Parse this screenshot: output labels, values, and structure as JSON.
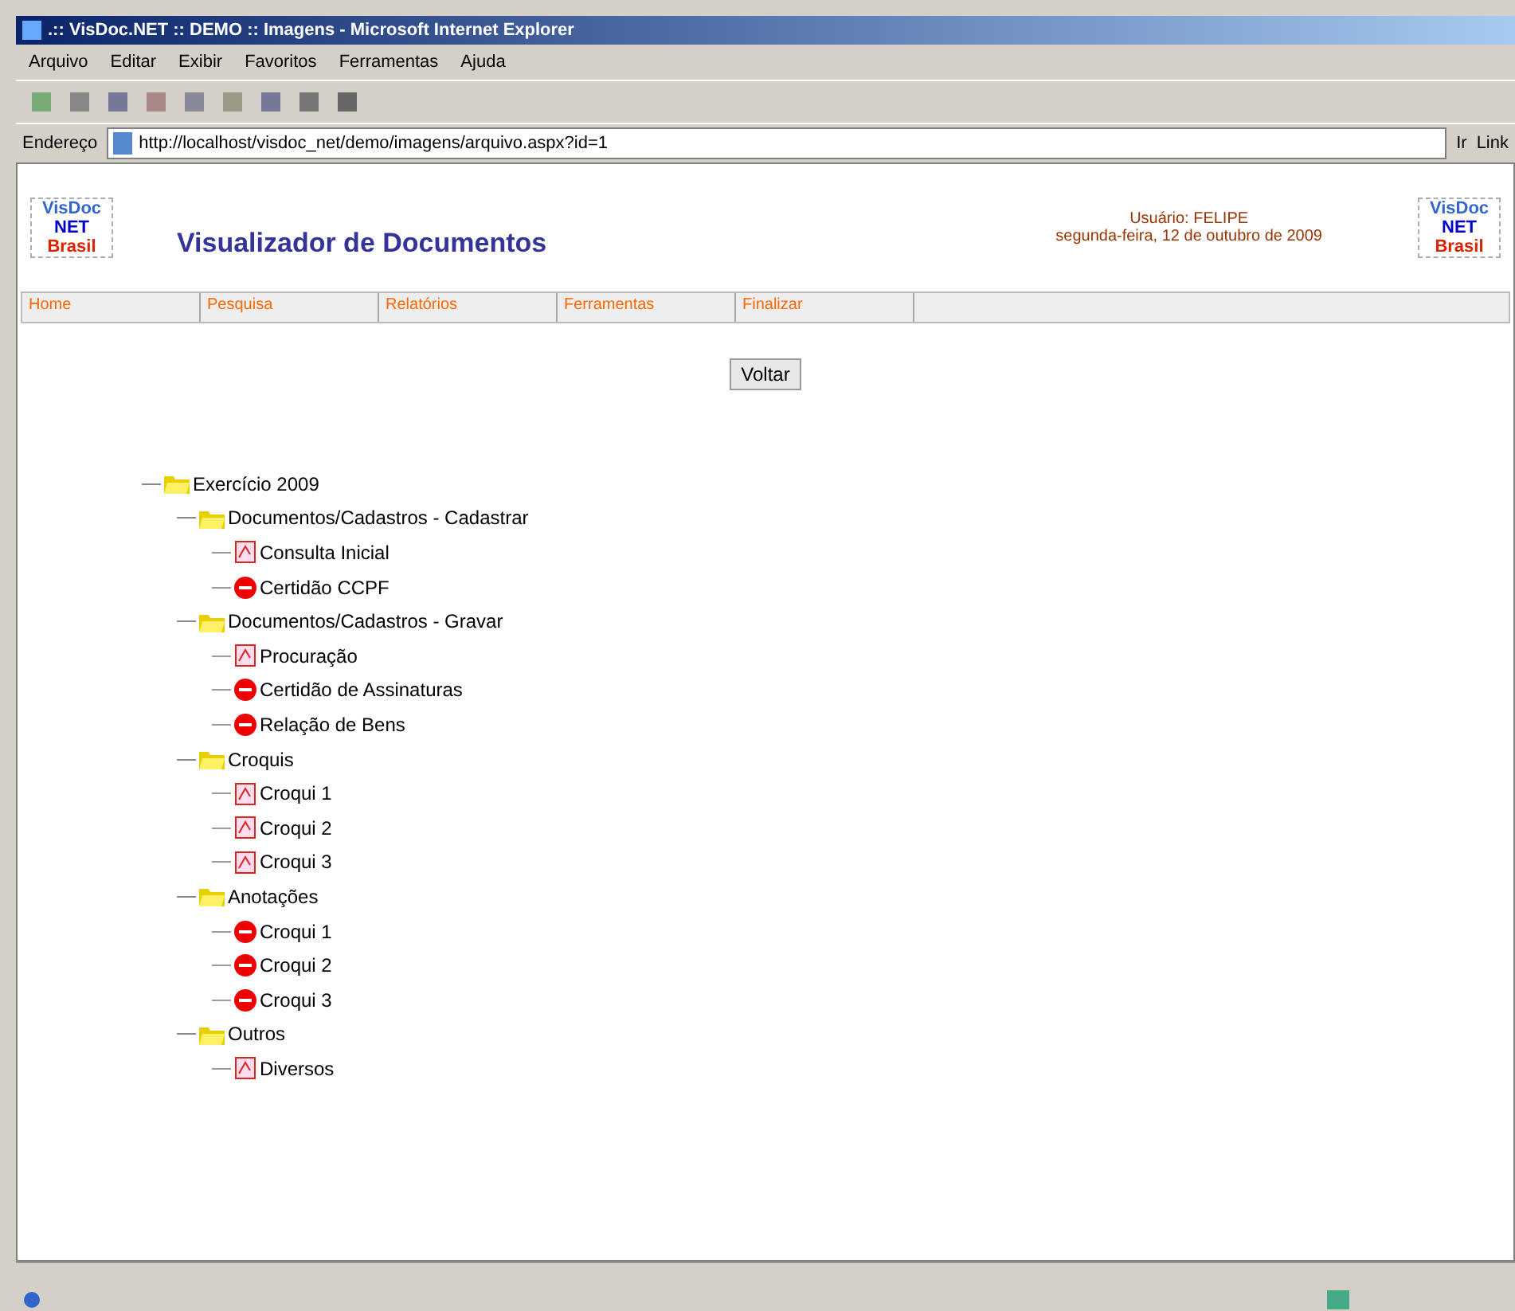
{
  "window": {
    "title": ".:: VisDoc.NET :: DEMO :: Imagens - Microsoft Internet Explorer"
  },
  "menu": [
    "Arquivo",
    "Editar",
    "Exibir",
    "Favoritos",
    "Ferramentas",
    "Ajuda"
  ],
  "address": {
    "label": "Endereço",
    "value": "http://localhost/visdoc_net/demo/imagens/arquivo.aspx?id=1",
    "go": "Ir",
    "links": "Link"
  },
  "header": {
    "title": "Visualizador de Documentos",
    "logos": [
      [
        "VisDoc",
        "NET",
        "Brasil"
      ],
      [
        "VisDoc",
        "NET",
        "Brasil"
      ]
    ],
    "user": "Usuário: FELIPE",
    "date": "segunda-feira, 12 de outubro de 2009"
  },
  "nav": [
    {
      "label": "Home"
    },
    {
      "label": "Pesquisa"
    },
    {
      "label": "Relatórios"
    },
    {
      "label": "Ferramentas"
    },
    {
      "label": "Finalizar"
    }
  ],
  "button": "Voltar",
  "tree": {
    "label": "Exercício 2009",
    "expanded": true,
    "children": [
      {
        "label": "Documentos/Cadastros - Cadastrar",
        "expanded": true,
        "children": [
          {
            "label": "Consulta Inicial",
            "kind": "doc"
          },
          {
            "label": "Certidão CCPF",
            "kind": "blocked"
          }
        ]
      },
      {
        "label": "Documentos/Cadastros - Gravar",
        "expanded": true,
        "children": [
          {
            "label": "Procuração",
            "kind": "doc"
          },
          {
            "label": "Certidão de Assinaturas",
            "kind": "blocked"
          },
          {
            "label": "Relação de Bens",
            "kind": "blocked"
          }
        ]
      },
      {
        "label": "Croquis",
        "expanded": true,
        "children": [
          {
            "label": "Croqui 1",
            "kind": "doc"
          },
          {
            "label": "Croqui 2",
            "kind": "doc"
          },
          {
            "label": "Croqui 3",
            "kind": "doc"
          }
        ]
      },
      {
        "label": "Anotações",
        "expanded": true,
        "children": [
          {
            "label": "Croqui 1",
            "kind": "blocked"
          },
          {
            "label": "Croqui 2",
            "kind": "blocked"
          },
          {
            "label": "Croqui 3",
            "kind": "blocked"
          }
        ]
      },
      {
        "label": "Outros",
        "expanded": true,
        "children": [
          {
            "label": "Diversos",
            "kind": "doc"
          }
        ]
      }
    ]
  }
}
